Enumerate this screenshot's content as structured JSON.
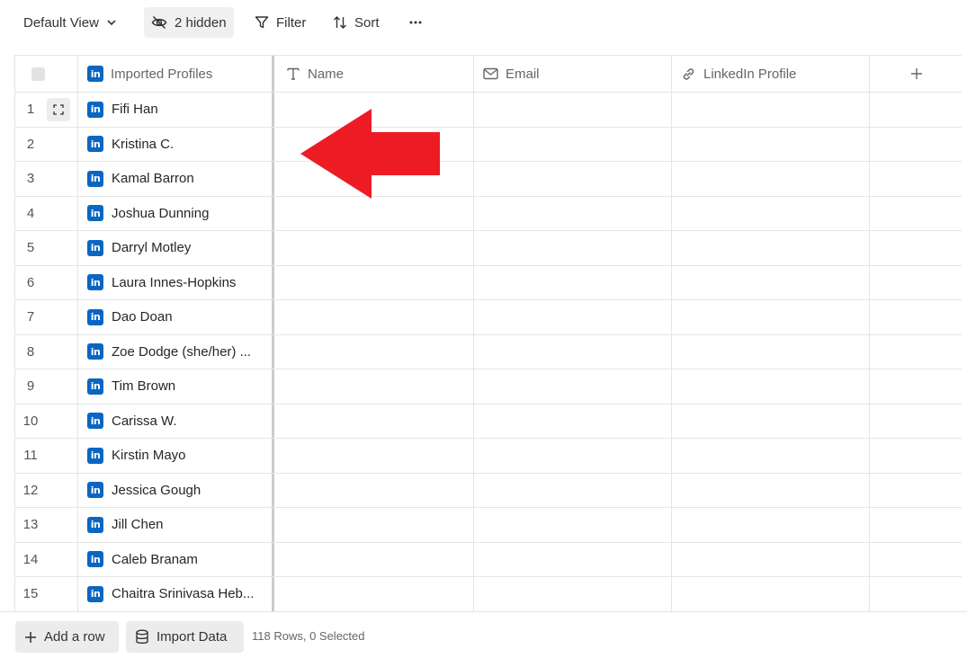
{
  "toolbar": {
    "view_label": "Default View",
    "hidden_label": "2 hidden",
    "filter_label": "Filter",
    "sort_label": "Sort"
  },
  "columns": {
    "profiles": "Imported Profiles",
    "name": "Name",
    "email": "Email",
    "linkedin": "LinkedIn Profile"
  },
  "badge_text": "in",
  "rows": [
    {
      "index": "1",
      "profile": "Fifi Han"
    },
    {
      "index": "2",
      "profile": "Kristina C."
    },
    {
      "index": "3",
      "profile": "Kamal Barron"
    },
    {
      "index": "4",
      "profile": "Joshua Dunning"
    },
    {
      "index": "5",
      "profile": "Darryl Motley"
    },
    {
      "index": "6",
      "profile": "Laura Innes-Hopkins"
    },
    {
      "index": "7",
      "profile": "Dao Doan"
    },
    {
      "index": "8",
      "profile": "Zoe Dodge (she/her) ..."
    },
    {
      "index": "9",
      "profile": "Tim Brown"
    },
    {
      "index": "10",
      "profile": "Carissa W."
    },
    {
      "index": "11",
      "profile": "Kirstin Mayo"
    },
    {
      "index": "12",
      "profile": "Jessica Gough"
    },
    {
      "index": "13",
      "profile": "Jill Chen"
    },
    {
      "index": "14",
      "profile": "Caleb Branam"
    },
    {
      "index": "15",
      "profile": "Chaitra Srinivasa Heb..."
    }
  ],
  "footer": {
    "add_row_label": "Add a row",
    "import_label": "Import Data",
    "status": "118 Rows, 0 Selected"
  },
  "colors": {
    "linkedin": "#0a66c2",
    "annotation_arrow": "#ed1c24"
  },
  "icons": [
    "chevron-down-icon",
    "eye-off-icon",
    "filter-icon",
    "sort-icon",
    "more-icon",
    "text-icon",
    "mail-icon",
    "link-icon",
    "plus-icon",
    "expand-icon",
    "linkedin-icon",
    "database-icon"
  ]
}
